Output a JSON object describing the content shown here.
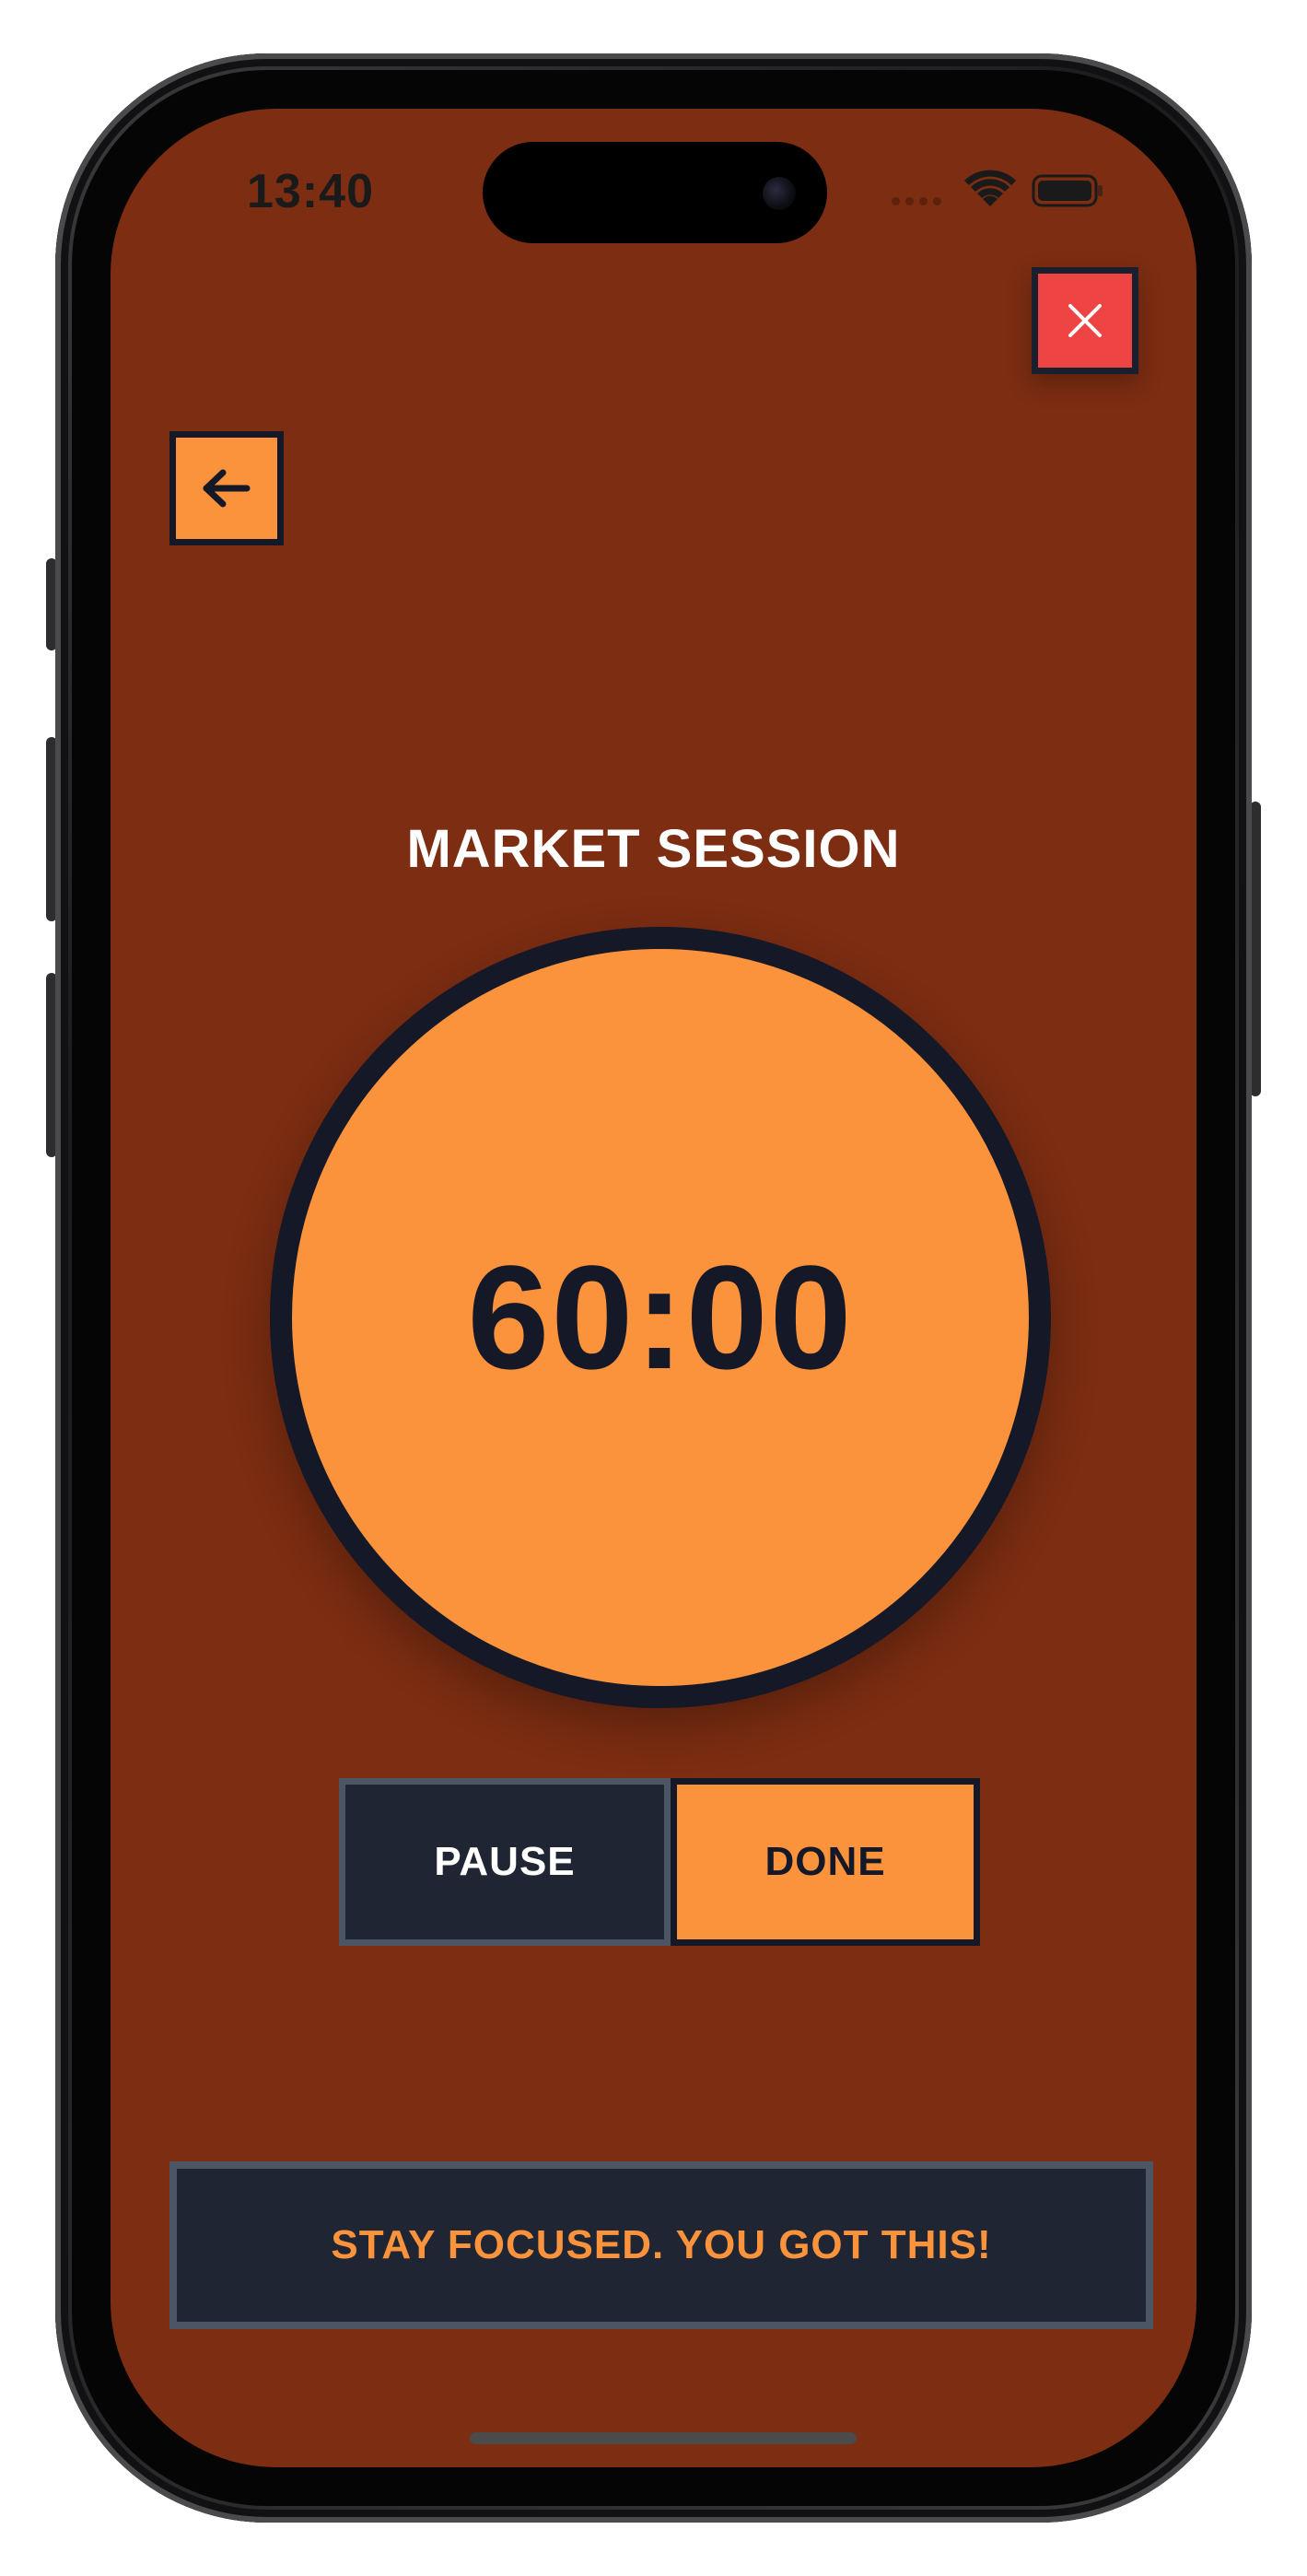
{
  "status_bar": {
    "time": "13:40"
  },
  "header": {
    "close_icon": "close-icon",
    "back_icon": "arrow-left-icon"
  },
  "session": {
    "title": "MARKET SESSION",
    "timer": "60:00"
  },
  "controls": {
    "pause_label": "PAUSE",
    "done_label": "DONE"
  },
  "banner": {
    "message": "STAY FOCUSED. YOU GOT THIS!"
  },
  "colors": {
    "background": "#7c2d12",
    "accent": "#fb923c",
    "dark": "#1f2533",
    "close": "#ef4444",
    "border_dark": "#141827",
    "border_gray": "#4b5563"
  }
}
